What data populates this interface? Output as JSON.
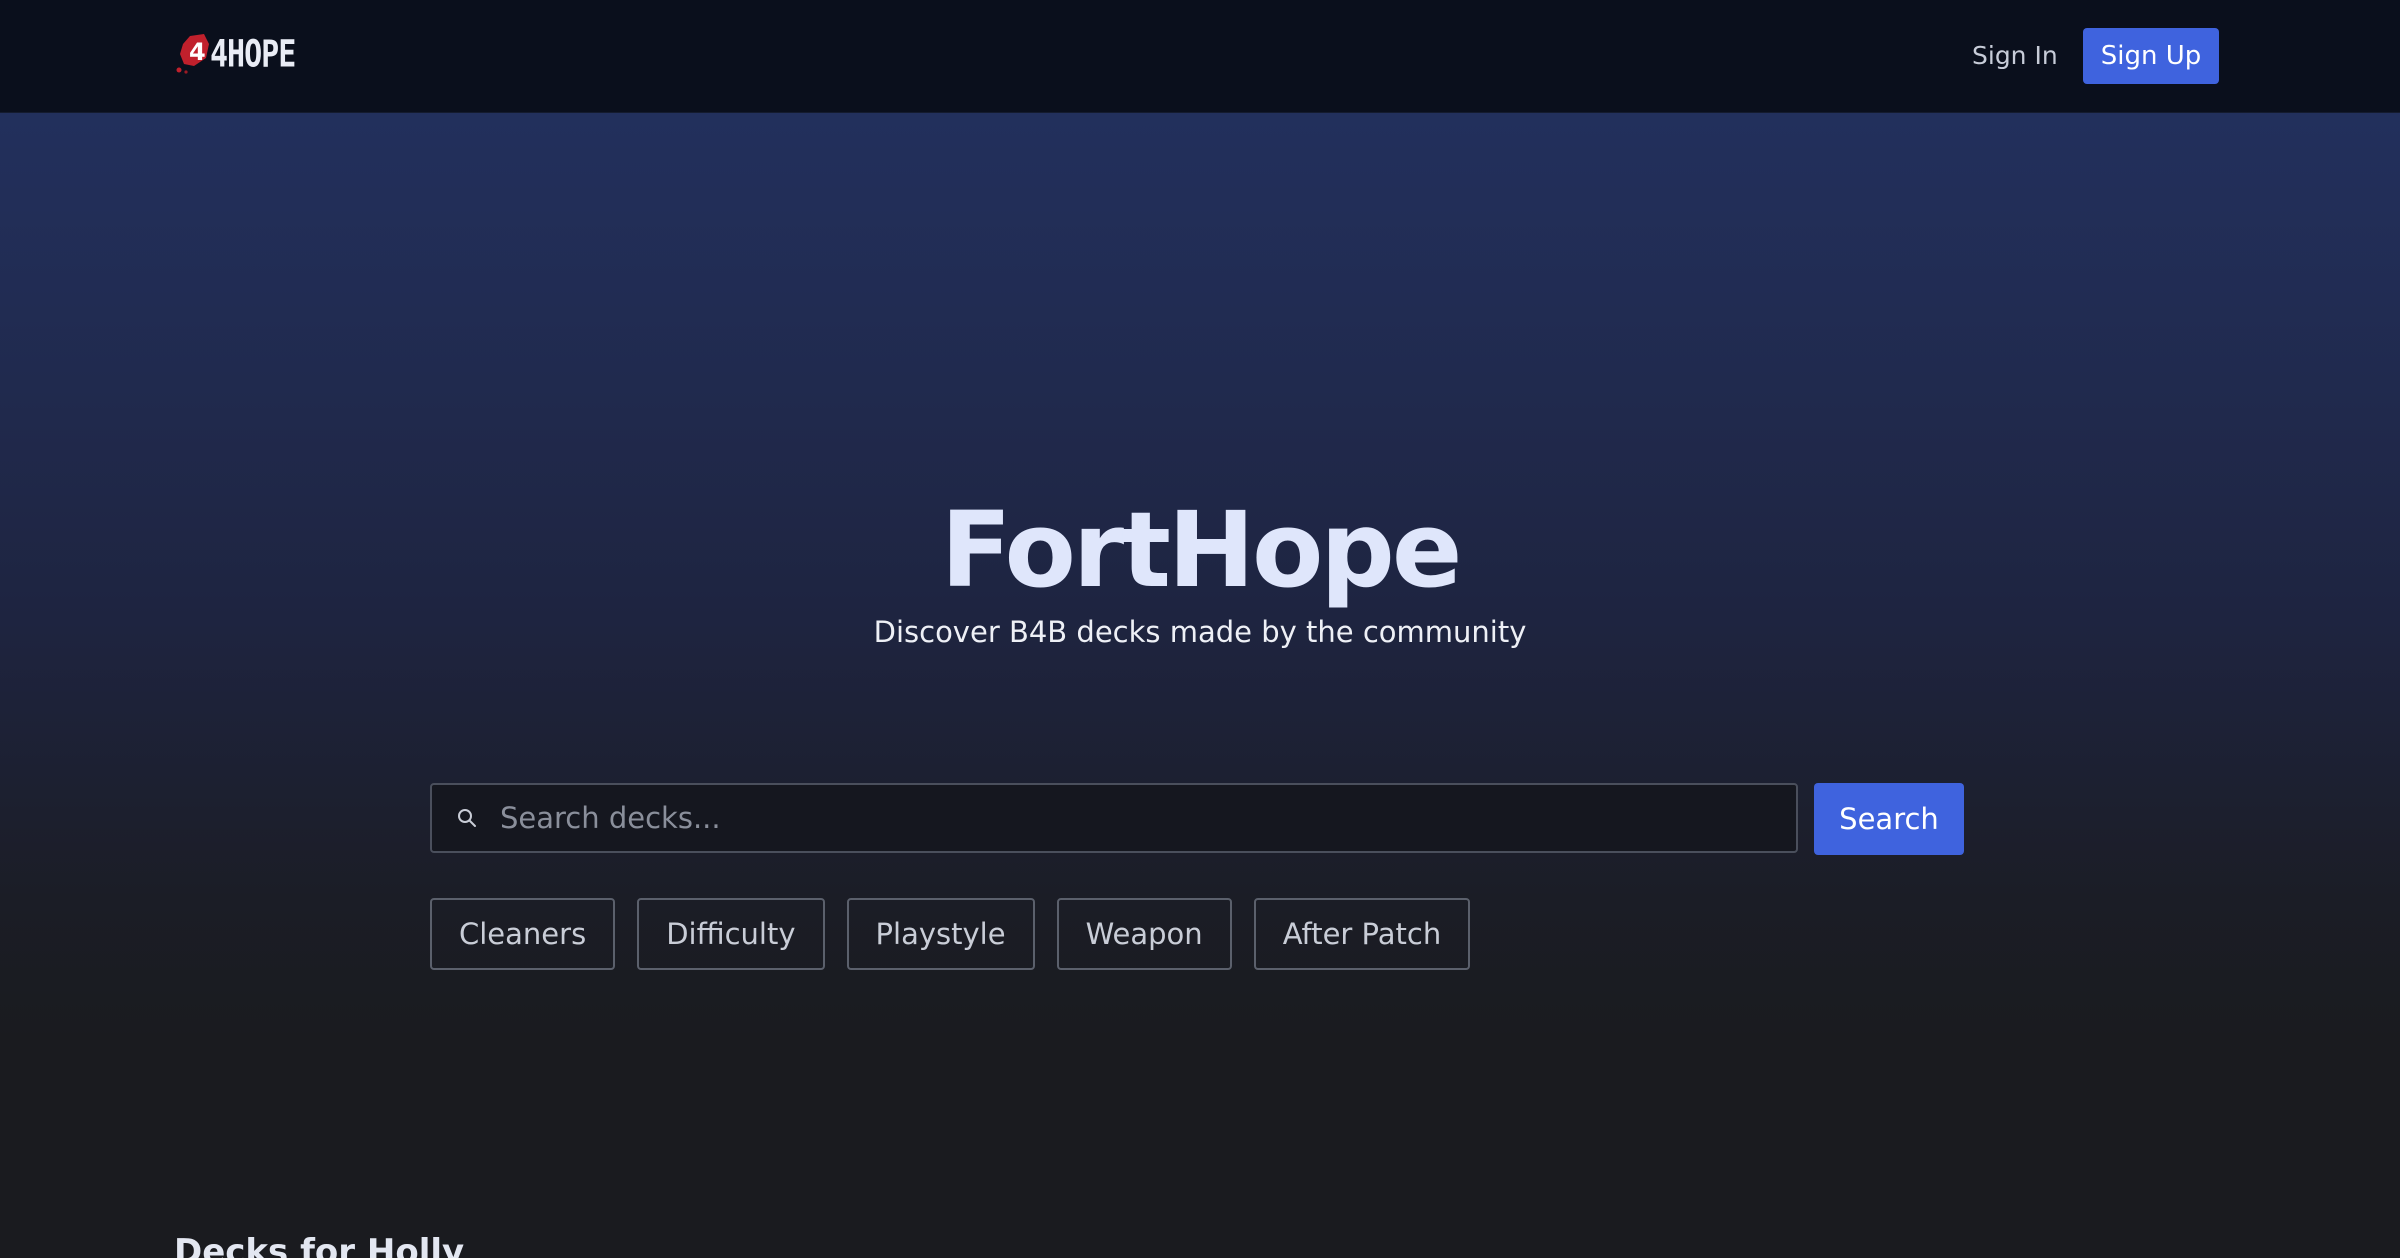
{
  "nav": {
    "logo_text": "4HOPE",
    "signin_label": "Sign In",
    "signup_label": "Sign Up"
  },
  "hero": {
    "title": "FortHope",
    "subtitle": "Discover B4B decks made by the community"
  },
  "search": {
    "placeholder": "Search decks...",
    "value": "",
    "button_label": "Search"
  },
  "filters": [
    {
      "label": "Cleaners"
    },
    {
      "label": "Difficulty"
    },
    {
      "label": "Playstyle"
    },
    {
      "label": "Weapon"
    },
    {
      "label": "After Patch"
    }
  ],
  "section": {
    "heading": "Decks for Holly"
  },
  "colors": {
    "accent": "#3f63de",
    "nav_bg": "#0a0f1c",
    "hero_title": "#dfe6fb",
    "logo_red": "#c0202c"
  },
  "icons": {
    "search": "search-icon",
    "logo": "logo-mark-icon"
  }
}
